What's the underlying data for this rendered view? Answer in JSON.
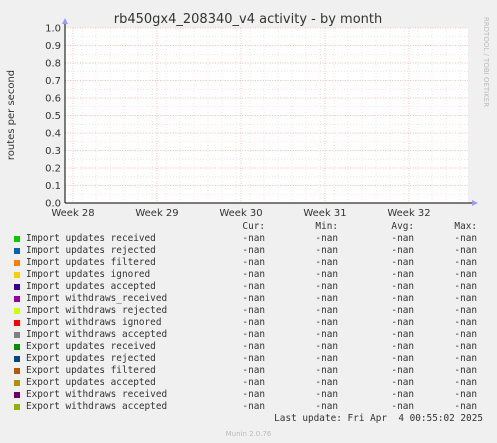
{
  "chart_data": {
    "type": "line",
    "title": "rb450gx4_208340_v4 activity - by month",
    "ylabel": "routes per second",
    "side_text": "RRDTOOL / TOBI OETIKER",
    "ylim": [
      0.0,
      1.0
    ],
    "y_ticks": [
      "0.0",
      "0.1",
      "0.2",
      "0.3",
      "0.4",
      "0.5",
      "0.6",
      "0.7",
      "0.8",
      "0.9",
      "1.0"
    ],
    "x_ticks": [
      "Week 28",
      "Week 29",
      "Week 30",
      "Week 31",
      "Week 32"
    ],
    "grid": true,
    "series": []
  },
  "legend": {
    "headers": [
      "Cur:",
      "Min:",
      "Avg:",
      "Max:"
    ],
    "rows": [
      {
        "name": "Import updates received",
        "color": "#00cc00",
        "cur": "-nan",
        "min": "-nan",
        "avg": "-nan",
        "max": "-nan"
      },
      {
        "name": "Import updates rejected",
        "color": "#0066b3",
        "cur": "-nan",
        "min": "-nan",
        "avg": "-nan",
        "max": "-nan"
      },
      {
        "name": "Import updates filtered",
        "color": "#ff8000",
        "cur": "-nan",
        "min": "-nan",
        "avg": "-nan",
        "max": "-nan"
      },
      {
        "name": "Import updates ignored",
        "color": "#ffcc00",
        "cur": "-nan",
        "min": "-nan",
        "avg": "-nan",
        "max": "-nan"
      },
      {
        "name": "Import updates accepted",
        "color": "#330099",
        "cur": "-nan",
        "min": "-nan",
        "avg": "-nan",
        "max": "-nan"
      },
      {
        "name": "Import withdraws_received",
        "color": "#990099",
        "cur": "-nan",
        "min": "-nan",
        "avg": "-nan",
        "max": "-nan"
      },
      {
        "name": "Import withdraws rejected",
        "color": "#ccff00",
        "cur": "-nan",
        "min": "-nan",
        "avg": "-nan",
        "max": "-nan"
      },
      {
        "name": "Import withdraws ignored",
        "color": "#ff0000",
        "cur": "-nan",
        "min": "-nan",
        "avg": "-nan",
        "max": "-nan"
      },
      {
        "name": "Import withdraws accepted",
        "color": "#808080",
        "cur": "-nan",
        "min": "-nan",
        "avg": "-nan",
        "max": "-nan"
      },
      {
        "name": "Export updates received",
        "color": "#008f00",
        "cur": "-nan",
        "min": "-nan",
        "avg": "-nan",
        "max": "-nan"
      },
      {
        "name": "Export updates rejected",
        "color": "#00487d",
        "cur": "-nan",
        "min": "-nan",
        "avg": "-nan",
        "max": "-nan"
      },
      {
        "name": "Export updates filtered",
        "color": "#b35a00",
        "cur": "-nan",
        "min": "-nan",
        "avg": "-nan",
        "max": "-nan"
      },
      {
        "name": "Export updates accepted",
        "color": "#b38f00",
        "cur": "-nan",
        "min": "-nan",
        "avg": "-nan",
        "max": "-nan"
      },
      {
        "name": "Export withdraws received",
        "color": "#6b006b",
        "cur": "-nan",
        "min": "-nan",
        "avg": "-nan",
        "max": "-nan"
      },
      {
        "name": "Export withdraws accepted",
        "color": "#8fb300",
        "cur": "-nan",
        "min": "-nan",
        "avg": "-nan",
        "max": "-nan"
      }
    ]
  },
  "footer": {
    "last_update": "Last update: Fri Apr  4 00:55:02 2025",
    "generator": "Munin 2.0.76"
  }
}
